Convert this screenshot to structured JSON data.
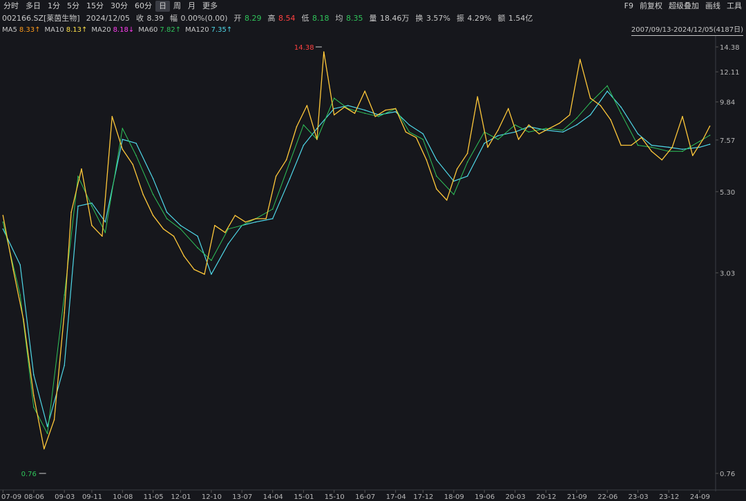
{
  "period_tabs": [
    "分时",
    "多日",
    "1分",
    "5分",
    "15分",
    "30分",
    "60分",
    "日",
    "周",
    "月",
    "更多"
  ],
  "active_tab": "日",
  "tools": [
    "F9",
    "前复权",
    "超级叠加",
    "画线",
    "工具"
  ],
  "quote": {
    "name": "002166.SZ[莱茵生物]",
    "date": "2024/12/05",
    "close_label": "收",
    "close": "8.39",
    "change_label": "幅",
    "change": "0.00%(0.00)",
    "open_label": "开",
    "open": "8.29",
    "high_label": "高",
    "high": "8.54",
    "low_label": "低",
    "low": "8.18",
    "avg_label": "均",
    "avg": "8.35",
    "vol_label": "量",
    "vol": "18.46万",
    "turnover_label": "换",
    "turnover": "3.57%",
    "amp_label": "振",
    "amp": "4.29%",
    "amount_label": "额",
    "amount": "1.54亿"
  },
  "ma": [
    {
      "label": "MA5",
      "value": "8.33↑",
      "color": "#ff9a1a"
    },
    {
      "label": "MA10",
      "value": "8.13↑",
      "color": "#ffe24a"
    },
    {
      "label": "MA20",
      "value": "8.18↓",
      "color": "#ff3df0"
    },
    {
      "label": "MA60",
      "value": "7.82↑",
      "color": "#2fc45a"
    },
    {
      "label": "MA120",
      "value": "7.35↑",
      "color": "#4fd8e8"
    }
  ],
  "range": "2007/09/13-2024/12/05(4187日)",
  "colors": {
    "up": "#ff4040",
    "down": "#2fc45a",
    "bg": "#16171c",
    "grid": "#2a2c33"
  },
  "chart_data": {
    "type": "line",
    "scale": "log",
    "yticks": [
      "14.38",
      "12.11",
      "9.84",
      "7.57",
      "5.30",
      "3.03",
      "0.76"
    ],
    "ylim": [
      0.76,
      14.38
    ],
    "xticks": [
      "07-09",
      "08-06",
      "09-03",
      "09-11",
      "10-08",
      "11-05",
      "12-01",
      "12-10",
      "13-07",
      "14-04",
      "15-01",
      "15-10",
      "16-07",
      "17-04",
      "17-12",
      "18-09",
      "19-06",
      "20-03",
      "20-12",
      "21-09",
      "22-06",
      "23-03",
      "23-12",
      "24-09"
    ],
    "annotations": {
      "max": "14.38",
      "min": "0.76"
    },
    "series": [
      {
        "name": "MA120",
        "x": [
          "2007-09",
          "2008-02",
          "2008-06",
          "2008-10",
          "2009-03",
          "2009-07",
          "2009-11",
          "2010-03",
          "2010-08",
          "2010-12",
          "2011-05",
          "2011-09",
          "2012-01",
          "2012-06",
          "2012-10",
          "2013-03",
          "2013-07",
          "2013-11",
          "2014-04",
          "2014-09",
          "2015-01",
          "2015-05",
          "2015-10",
          "2016-02",
          "2016-07",
          "2016-11",
          "2017-04",
          "2017-08",
          "2017-12",
          "2018-04",
          "2018-09",
          "2019-01",
          "2019-06",
          "2019-10",
          "2020-03",
          "2020-07",
          "2020-12",
          "2021-05",
          "2021-09",
          "2022-01",
          "2022-06",
          "2022-10",
          "2023-03",
          "2023-07",
          "2023-12",
          "2024-04",
          "2024-09",
          "2024-12"
        ],
        "values": [
          4.1,
          3.2,
          1.5,
          1.05,
          1.6,
          4.8,
          4.9,
          4.3,
          7.6,
          7.4,
          5.8,
          4.6,
          4.2,
          3.9,
          3.0,
          3.7,
          4.2,
          4.3,
          4.4,
          5.8,
          7.3,
          8.2,
          9.4,
          9.6,
          9.3,
          9.0,
          9.2,
          8.4,
          7.9,
          6.6,
          5.7,
          5.9,
          7.4,
          7.8,
          8.0,
          8.3,
          8.1,
          8.0,
          8.4,
          9.0,
          10.6,
          9.5,
          7.9,
          7.3,
          7.2,
          7.1,
          7.2,
          7.35
        ]
      },
      {
        "name": "MA60",
        "x": [
          "2007-09",
          "2008-02",
          "2008-06",
          "2008-10",
          "2009-03",
          "2009-07",
          "2009-11",
          "2010-03",
          "2010-08",
          "2010-12",
          "2011-05",
          "2011-09",
          "2012-01",
          "2012-06",
          "2012-10",
          "2013-03",
          "2013-07",
          "2013-11",
          "2014-04",
          "2014-09",
          "2015-01",
          "2015-05",
          "2015-10",
          "2016-02",
          "2016-07",
          "2016-11",
          "2017-04",
          "2017-08",
          "2017-12",
          "2018-04",
          "2018-09",
          "2019-01",
          "2019-06",
          "2019-10",
          "2020-03",
          "2020-07",
          "2020-12",
          "2021-05",
          "2021-09",
          "2022-01",
          "2022-06",
          "2022-10",
          "2023-03",
          "2023-07",
          "2023-12",
          "2024-04",
          "2024-09",
          "2024-12"
        ],
        "values": [
          4.3,
          2.6,
          1.2,
          1.0,
          2.6,
          5.9,
          4.8,
          4.0,
          8.2,
          6.8,
          5.2,
          4.4,
          4.1,
          3.6,
          3.3,
          4.1,
          4.2,
          4.4,
          4.7,
          6.5,
          8.4,
          7.6,
          10.1,
          9.4,
          9.1,
          8.9,
          9.4,
          8.0,
          7.6,
          5.9,
          5.2,
          6.5,
          8.0,
          7.6,
          8.4,
          8.0,
          8.2,
          8.1,
          8.8,
          9.8,
          11.0,
          9.1,
          7.3,
          7.2,
          7.0,
          7.0,
          7.5,
          7.82
        ]
      },
      {
        "name": "MA5",
        "x": [
          "2007-09",
          "2007-12",
          "2008-03",
          "2008-06",
          "2008-09",
          "2008-12",
          "2009-03",
          "2009-05",
          "2009-08",
          "2009-11",
          "2010-02",
          "2010-05",
          "2010-08",
          "2010-11",
          "2011-02",
          "2011-05",
          "2011-08",
          "2011-11",
          "2012-02",
          "2012-05",
          "2012-08",
          "2012-11",
          "2013-02",
          "2013-05",
          "2013-08",
          "2013-11",
          "2014-02",
          "2014-05",
          "2014-08",
          "2014-11",
          "2015-02",
          "2015-05",
          "2015-07",
          "2015-10",
          "2016-01",
          "2016-04",
          "2016-07",
          "2016-10",
          "2017-01",
          "2017-04",
          "2017-07",
          "2017-10",
          "2018-01",
          "2018-04",
          "2018-07",
          "2018-10",
          "2019-01",
          "2019-04",
          "2019-07",
          "2019-10",
          "2020-01",
          "2020-04",
          "2020-07",
          "2020-10",
          "2021-01",
          "2021-04",
          "2021-07",
          "2021-10",
          "2022-01",
          "2022-04",
          "2022-07",
          "2022-10",
          "2023-01",
          "2023-04",
          "2023-07",
          "2023-10",
          "2024-01",
          "2024-04",
          "2024-07",
          "2024-10",
          "2024-12"
        ],
        "values": [
          4.5,
          3.1,
          2.2,
          1.3,
          0.9,
          1.1,
          2.3,
          4.6,
          6.2,
          4.2,
          3.9,
          8.9,
          7.1,
          6.4,
          5.2,
          4.5,
          4.1,
          3.9,
          3.4,
          3.1,
          3.0,
          4.2,
          4.0,
          4.5,
          4.3,
          4.4,
          4.4,
          5.9,
          6.6,
          8.3,
          9.6,
          7.6,
          13.9,
          9.0,
          9.5,
          9.1,
          10.6,
          8.9,
          9.3,
          9.4,
          8.0,
          7.7,
          6.6,
          5.4,
          5.0,
          6.2,
          6.9,
          10.2,
          7.2,
          8.1,
          9.4,
          7.6,
          8.4,
          7.9,
          8.2,
          8.5,
          9.0,
          13.2,
          10.1,
          9.6,
          8.7,
          7.3,
          7.3,
          7.7,
          7.0,
          6.6,
          7.2,
          8.9,
          6.8,
          7.6,
          8.33
        ]
      }
    ]
  }
}
